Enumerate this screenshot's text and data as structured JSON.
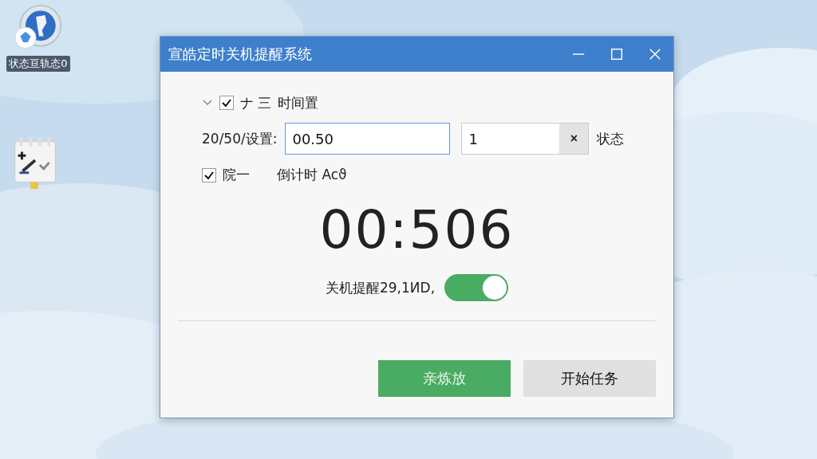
{
  "desktop_icons": [
    {
      "label": "状态亘轨态0",
      "kind": "globe"
    },
    {
      "kind": "calendar"
    }
  ],
  "window": {
    "title": "宣皓定时关机提醒系统"
  },
  "header_row": {
    "expanded": true,
    "checked": true,
    "glyph": "ナ 三",
    "label": "时间置"
  },
  "time_row": {
    "label": "20/50/设置:",
    "value": "00.50",
    "count_value": "1",
    "clear": "×",
    "status": "状态"
  },
  "option_row": {
    "checked": true,
    "label": "院一",
    "countdown": "倒计时 Acϑ"
  },
  "timer": "00:506",
  "reminder": {
    "label": "关机提醒29,1ИD,",
    "on": true
  },
  "buttons": [
    {
      "label": "亲炼放",
      "kind": "primary"
    },
    {
      "label": "开始任务",
      "kind": "secondary"
    }
  ]
}
